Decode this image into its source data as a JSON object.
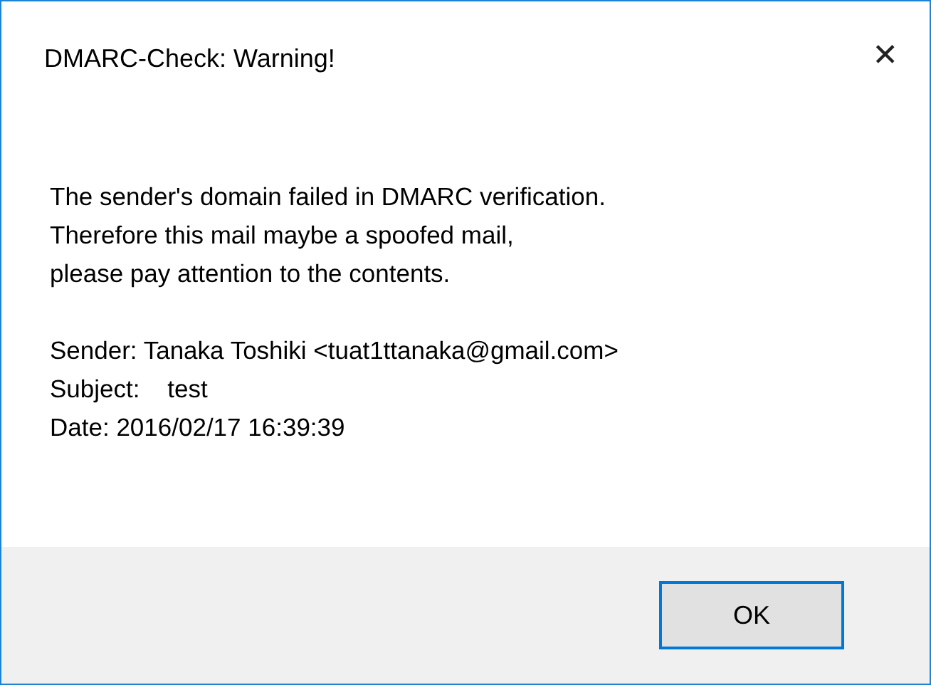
{
  "window": {
    "title": "DMARC-Check: Warning!",
    "close": "✕"
  },
  "message_lines": [
    "The sender's domain failed in DMARC verification.",
    "Therefore this mail maybe a spoofed mail,",
    "please pay attention to the contents."
  ],
  "details": [
    "Sender: Tanaka Toshiki <tuat1ttanaka@gmail.com>",
    "Subject:    test",
    "Date: 2016/02/17 16:39:39"
  ],
  "buttons": [
    {
      "label": "OK",
      "selected": true
    }
  ]
}
